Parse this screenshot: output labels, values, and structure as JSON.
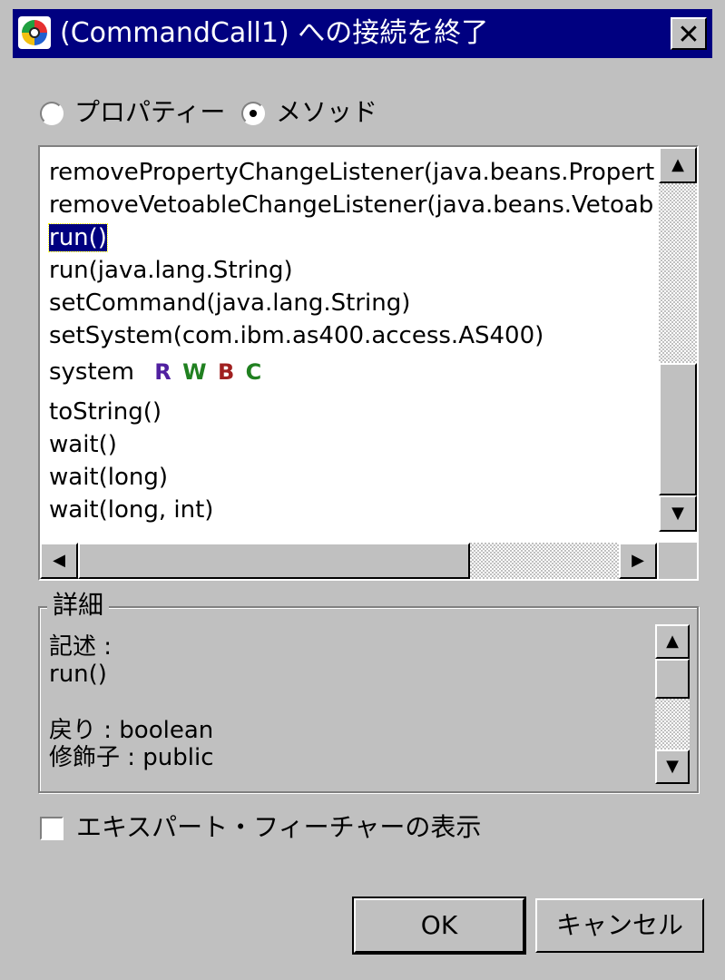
{
  "window": {
    "title": "(CommandCall1) への接続を終了",
    "close_label": "✕"
  },
  "radios": [
    {
      "label": "プロパティー",
      "checked": false
    },
    {
      "label": "メソッド",
      "checked": true
    }
  ],
  "methods": [
    {
      "text": "removePropertyChangeListener(java.beans.Propert",
      "selected": false
    },
    {
      "text": "removeVetoableChangeListener(java.beans.Vetoab",
      "selected": false
    },
    {
      "text": "run()",
      "selected": true
    },
    {
      "text": "run(java.lang.String)",
      "selected": false
    },
    {
      "text": "setCommand(java.lang.String)",
      "selected": false
    },
    {
      "text": "setSystem(com.ibm.as400.access.AS400)",
      "selected": false
    },
    {
      "text": "system",
      "selected": false,
      "badges": [
        {
          "letter": "R",
          "color": "#5020a0"
        },
        {
          "letter": "W",
          "color": "#208020"
        },
        {
          "letter": "B",
          "color": "#a02020"
        },
        {
          "letter": "C",
          "color": "#208020"
        }
      ]
    },
    {
      "text": "toString()",
      "selected": false
    },
    {
      "text": "wait()",
      "selected": false
    },
    {
      "text": "wait(long)",
      "selected": false
    },
    {
      "text": "wait(long, int)",
      "selected": false
    }
  ],
  "details": {
    "title": "詳細",
    "lines": [
      "記述 :",
      "run()",
      "",
      "戻り : boolean",
      "修飾子 :  public"
    ]
  },
  "expert_checkbox": {
    "label": "エキスパート・フィーチャーの表示",
    "checked": false
  },
  "buttons": {
    "ok": "OK",
    "cancel": "キャンセル"
  },
  "icons": {
    "up": "▲",
    "down": "▼",
    "left": "◀",
    "right": "▶"
  }
}
